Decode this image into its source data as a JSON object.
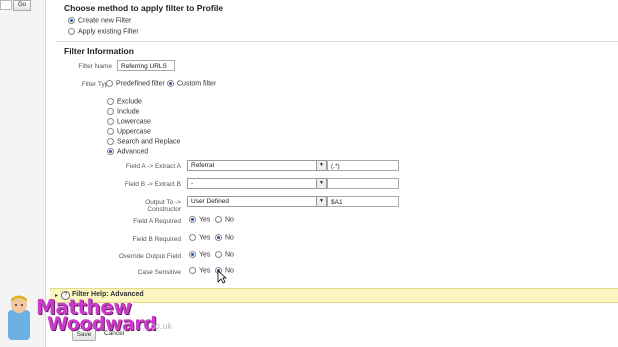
{
  "topbar": {
    "go_label": "Go"
  },
  "method": {
    "title": "Choose method to apply filter to Profile",
    "options": [
      {
        "label": "Create new Filter",
        "selected": true
      },
      {
        "label": "Apply existing Filter",
        "selected": false
      }
    ]
  },
  "filter_info": {
    "title": "Filter Information",
    "name_label": "Filter Name",
    "name_value": "Referring URLS",
    "type_label": "Filter Type",
    "type_options": [
      {
        "label": "Predefined filter",
        "selected": false
      },
      {
        "label": "Custom filter",
        "selected": true
      }
    ],
    "custom_options": [
      {
        "label": "Exclude",
        "selected": false
      },
      {
        "label": "Include",
        "selected": false
      },
      {
        "label": "Lowercase",
        "selected": false
      },
      {
        "label": "Uppercase",
        "selected": false
      },
      {
        "label": "Search and Replace",
        "selected": false
      },
      {
        "label": "Advanced",
        "selected": true
      }
    ]
  },
  "advanced": {
    "field_a": {
      "label": "Field A -> Extract A",
      "select_value": "Referral",
      "text_value": "(.*)"
    },
    "field_b": {
      "label": "Field B -> Extract B",
      "select_value": "-",
      "text_value": ""
    },
    "output": {
      "label": "Output To -> Constructor",
      "select_value": "User Defined",
      "text_value": "$A1"
    },
    "yesno": [
      {
        "label": "Field A Required",
        "yes": "Yes",
        "no": "No",
        "value": "yes"
      },
      {
        "label": "Field B Required",
        "yes": "Yes",
        "no": "No",
        "value": "no"
      },
      {
        "label": "Override Output Field",
        "yes": "Yes",
        "no": "No",
        "value": "yes"
      },
      {
        "label": "Case Sensitive",
        "yes": "Yes",
        "no": "No",
        "value": "no"
      }
    ]
  },
  "help": {
    "label": "Filter Help: Advanced"
  },
  "actions": {
    "save": "Save",
    "cancel": "Cancel"
  },
  "watermark": {
    "line1": "Matthew",
    "line2": "Woodward",
    "suffix": ".co.uk"
  }
}
